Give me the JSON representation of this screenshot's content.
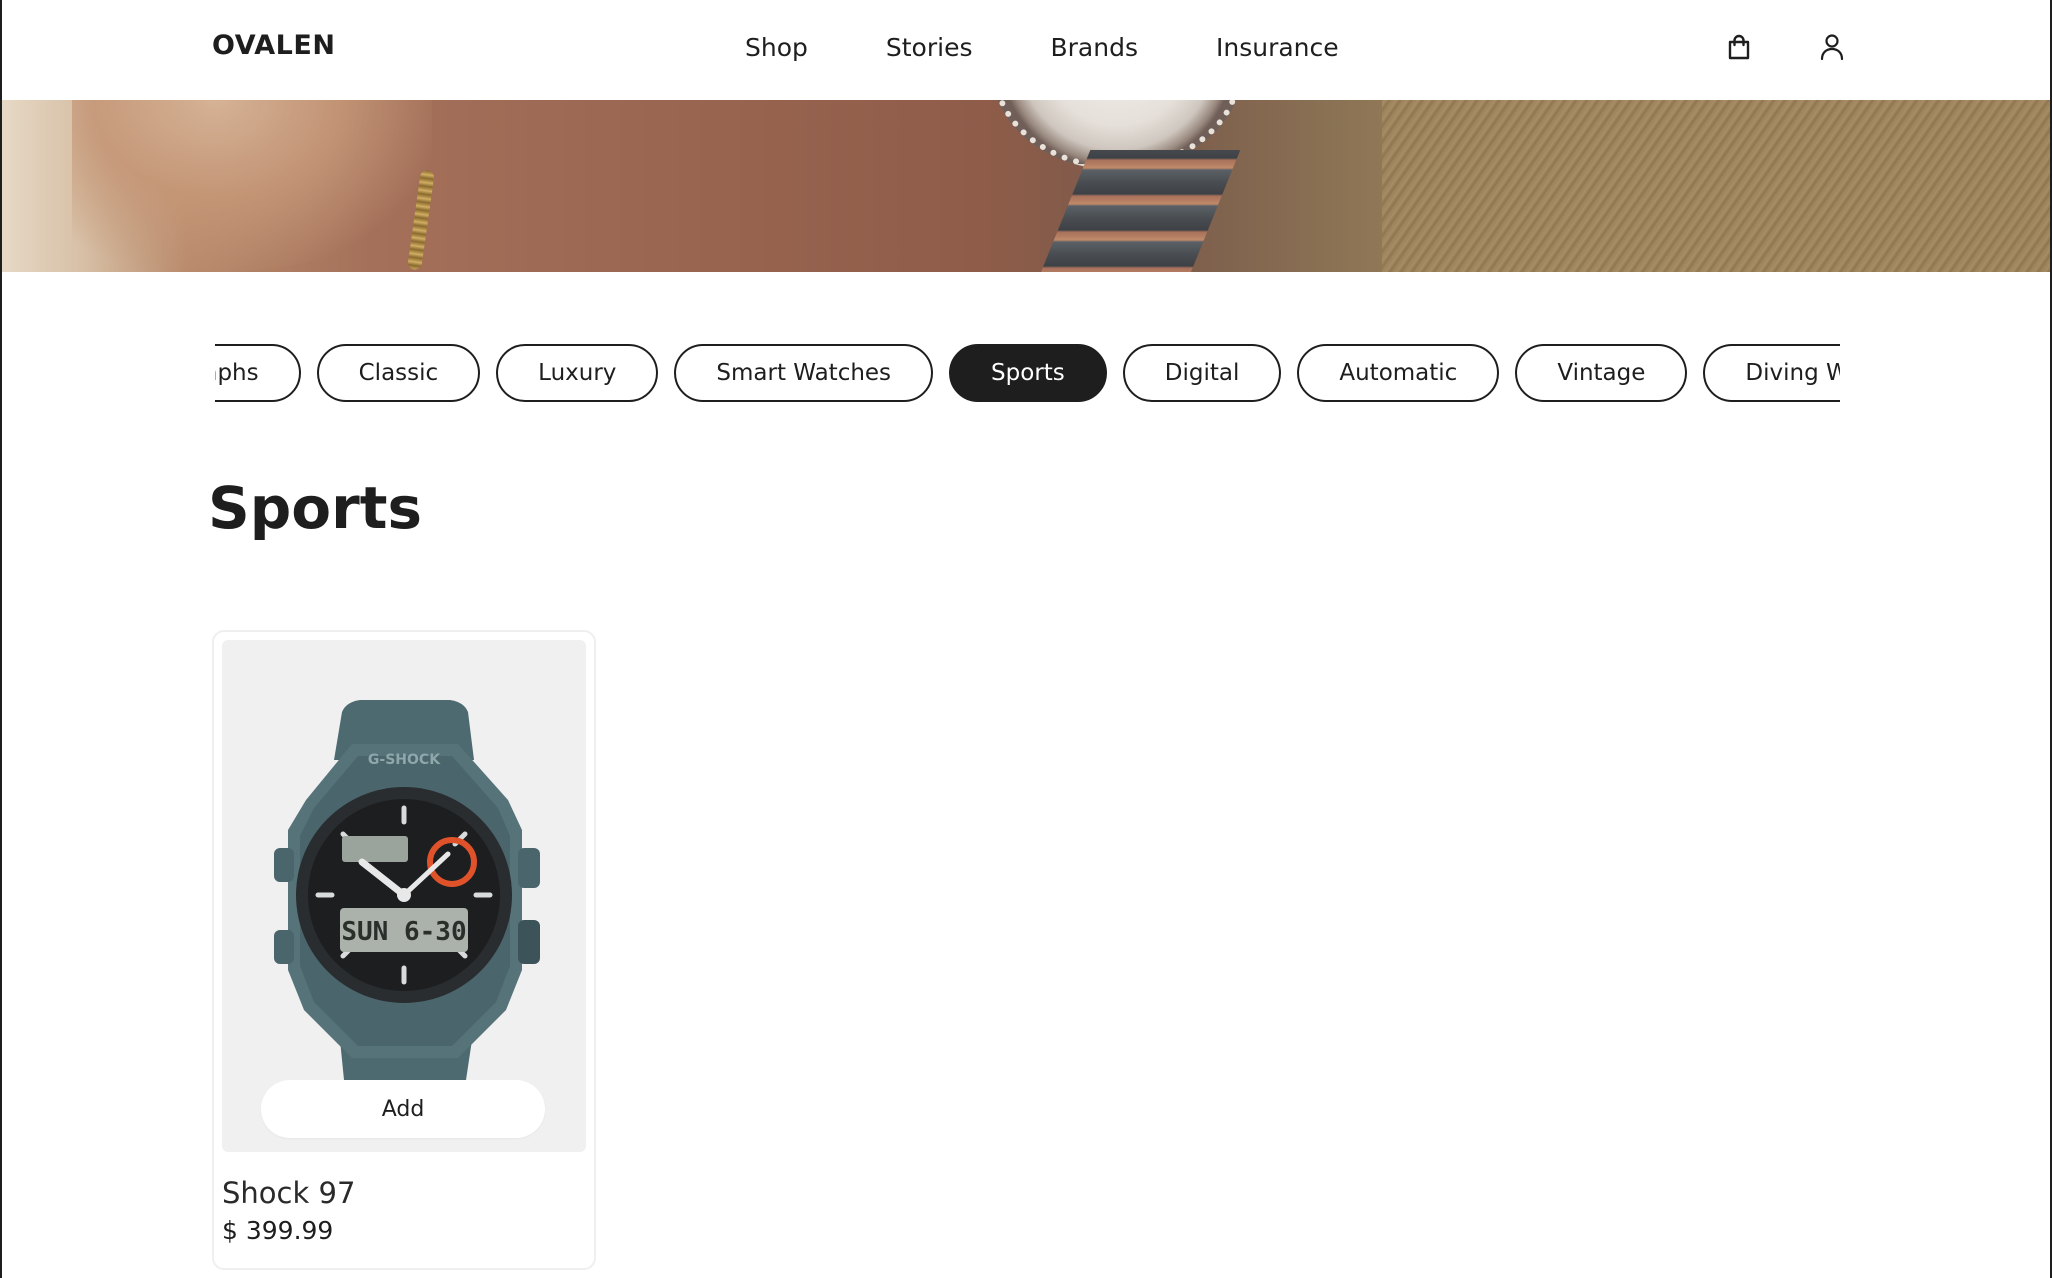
{
  "header": {
    "logo": "OVALEN",
    "nav": [
      {
        "label": "Shop"
      },
      {
        "label": "Stories"
      },
      {
        "label": "Brands"
      },
      {
        "label": "Insurance"
      }
    ],
    "icons": [
      "shopping-bag-icon",
      "user-icon"
    ]
  },
  "categories": {
    "items": [
      "Chronographs",
      "Classic",
      "Luxury",
      "Smart Watches",
      "Sports",
      "Digital",
      "Automatic",
      "Vintage",
      "Diving Watches"
    ],
    "active": "Sports"
  },
  "page": {
    "title": "Sports"
  },
  "products": [
    {
      "name": "Shock 97",
      "price": "$ 399.99",
      "add_label": "Add",
      "image_text": {
        "brand": "G-SHOCK",
        "lcd": "SUN  6-30"
      }
    }
  ],
  "colors": {
    "text": "#1e1e1e",
    "active_pill_bg": "#1e1e1e",
    "card_image_bg": "#f0f0f0",
    "watch_case": "#4d6a70"
  }
}
